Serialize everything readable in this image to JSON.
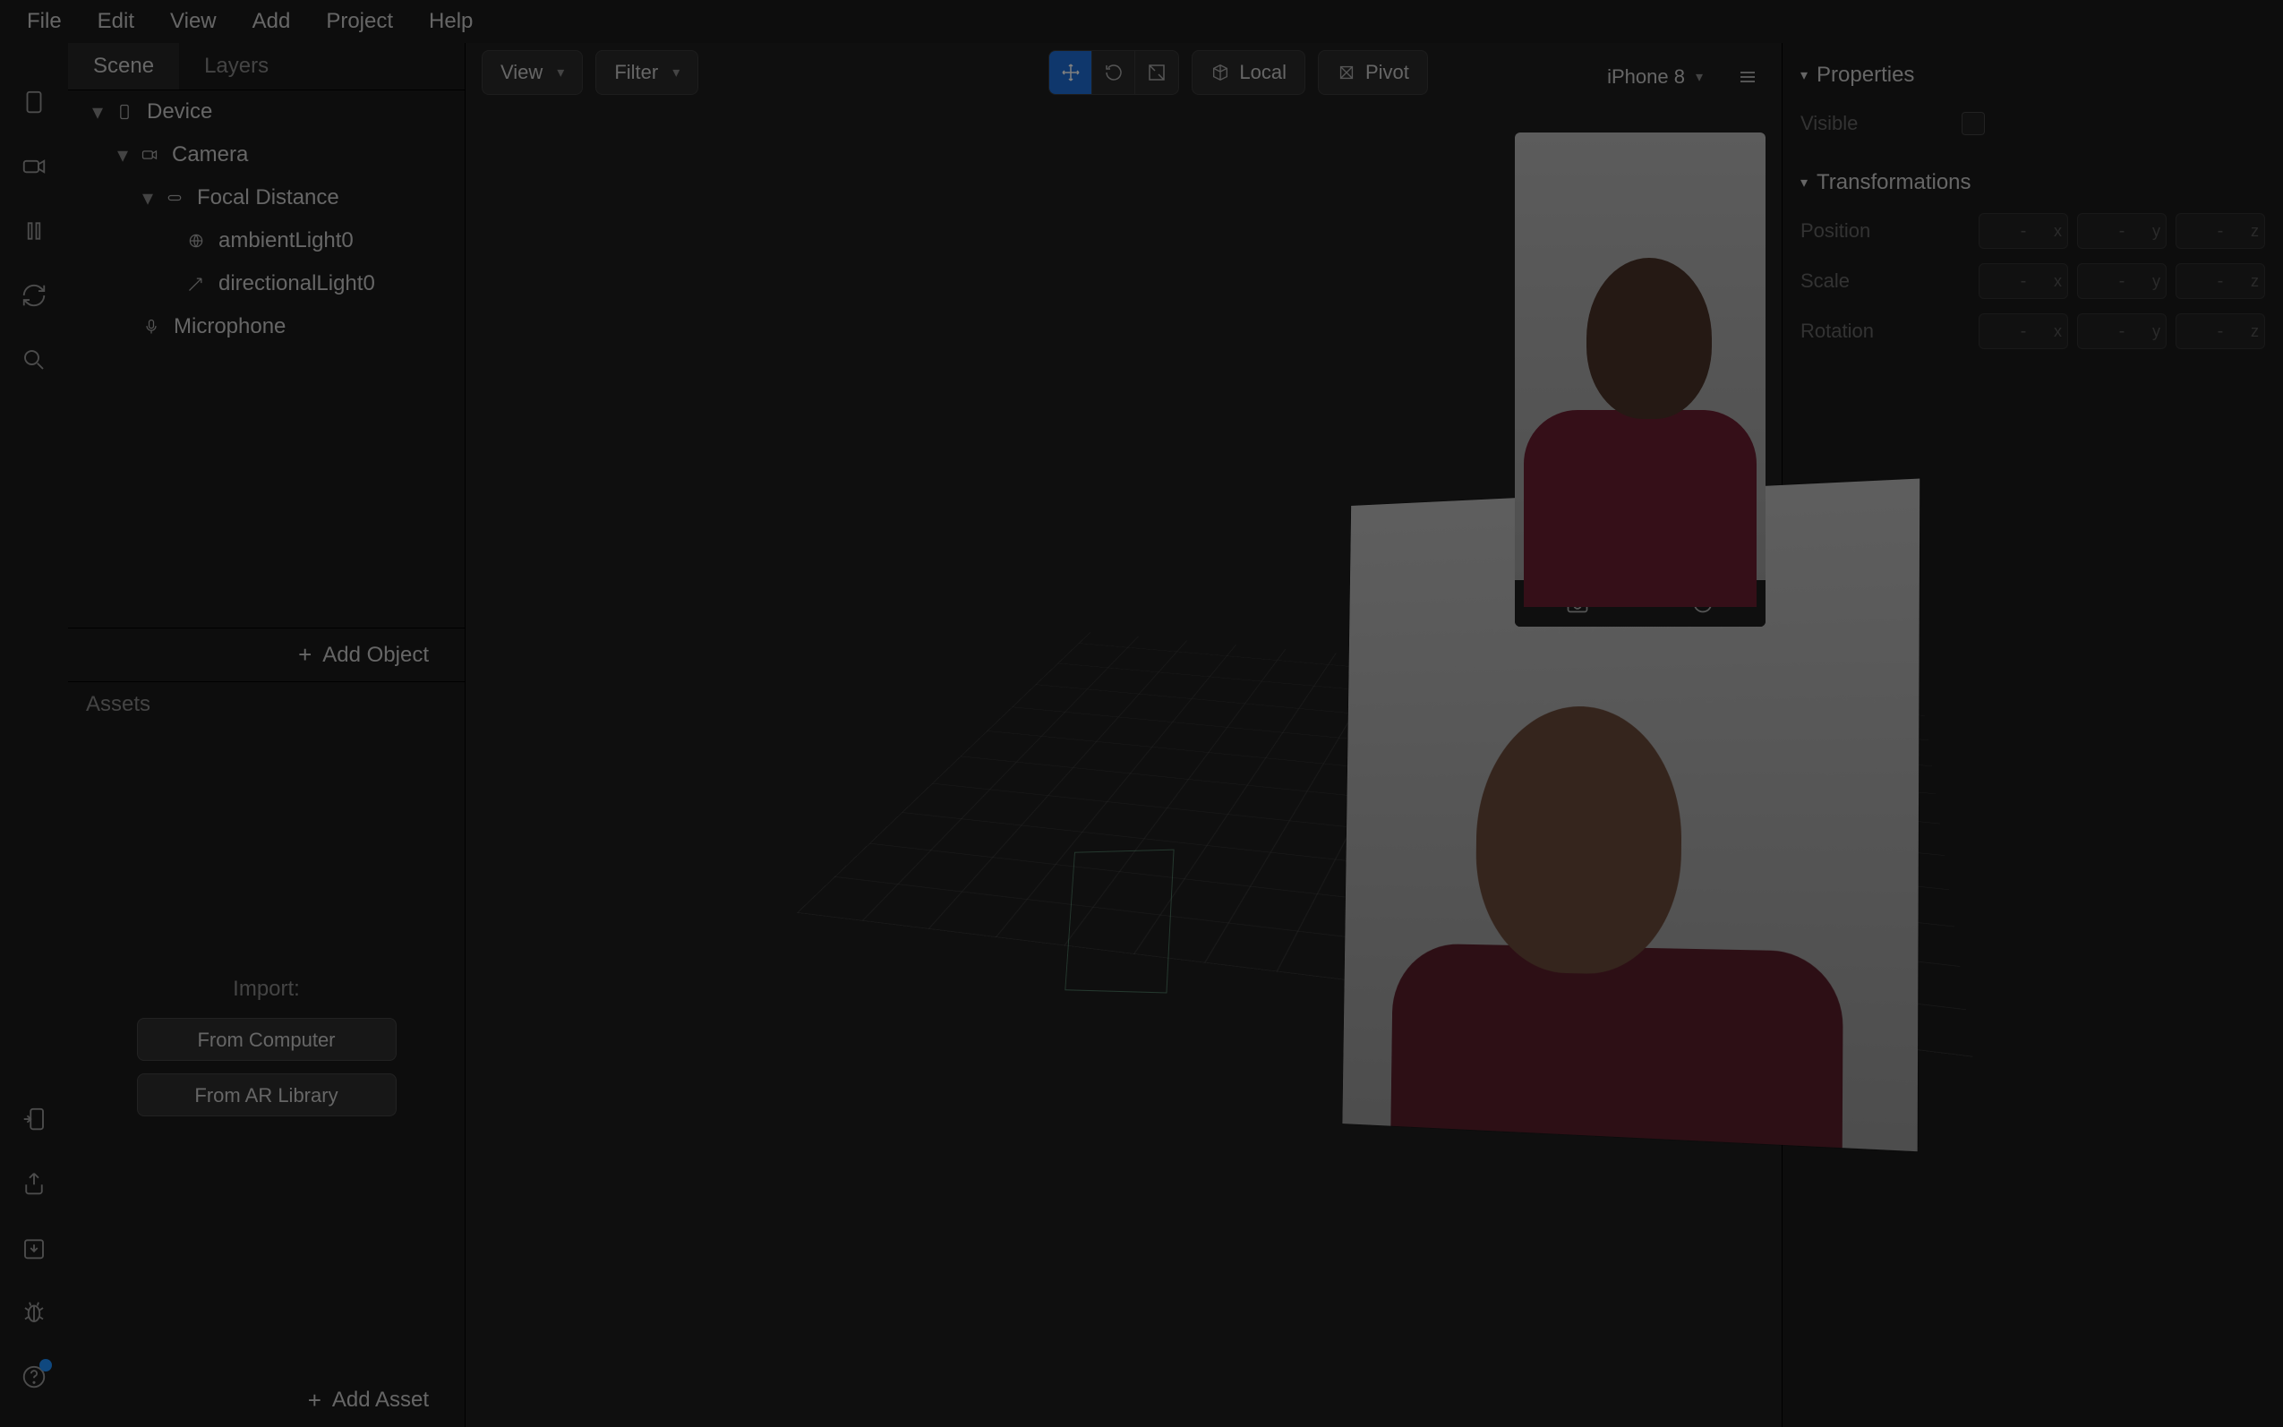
{
  "menubar": [
    "File",
    "Edit",
    "View",
    "Add",
    "Project",
    "Help"
  ],
  "leftPanel": {
    "tabs": [
      {
        "label": "Scene",
        "active": true
      },
      {
        "label": "Layers",
        "active": false
      }
    ],
    "tree": [
      {
        "indent": 0,
        "caret": true,
        "icon": "device",
        "label": "Device"
      },
      {
        "indent": 1,
        "caret": true,
        "icon": "camera",
        "label": "Camera"
      },
      {
        "indent": 2,
        "caret": true,
        "icon": "focal",
        "label": "Focal Distance"
      },
      {
        "indent": 3,
        "caret": false,
        "icon": "ambient",
        "label": "ambientLight0"
      },
      {
        "indent": 3,
        "caret": false,
        "icon": "directional",
        "label": "directionalLight0"
      },
      {
        "indent": 1,
        "caret": false,
        "icon": "mic",
        "label": "Microphone"
      }
    ],
    "addObject": "Add Object",
    "assetsHeader": "Assets",
    "importLabel": "Import:",
    "importButtons": [
      "From Computer",
      "From AR Library"
    ],
    "addAsset": "Add Asset"
  },
  "viewport": {
    "viewBtn": "View",
    "filterBtn": "Filter",
    "localBtn": "Local",
    "pivotBtn": "Pivot",
    "deviceSel": "iPhone 8"
  },
  "rightPanel": {
    "sections": [
      {
        "title": "Properties",
        "rows": [
          {
            "label": "Visible",
            "type": "checkbox"
          }
        ]
      },
      {
        "title": "Transformations",
        "rows": [
          {
            "label": "Position",
            "type": "xyz",
            "values": [
              "-",
              "-",
              "-"
            ]
          },
          {
            "label": "Scale",
            "type": "xyz",
            "values": [
              "-",
              "-",
              "-"
            ]
          },
          {
            "label": "Rotation",
            "type": "xyz",
            "values": [
              "-",
              "-",
              "-"
            ]
          }
        ]
      }
    ]
  }
}
